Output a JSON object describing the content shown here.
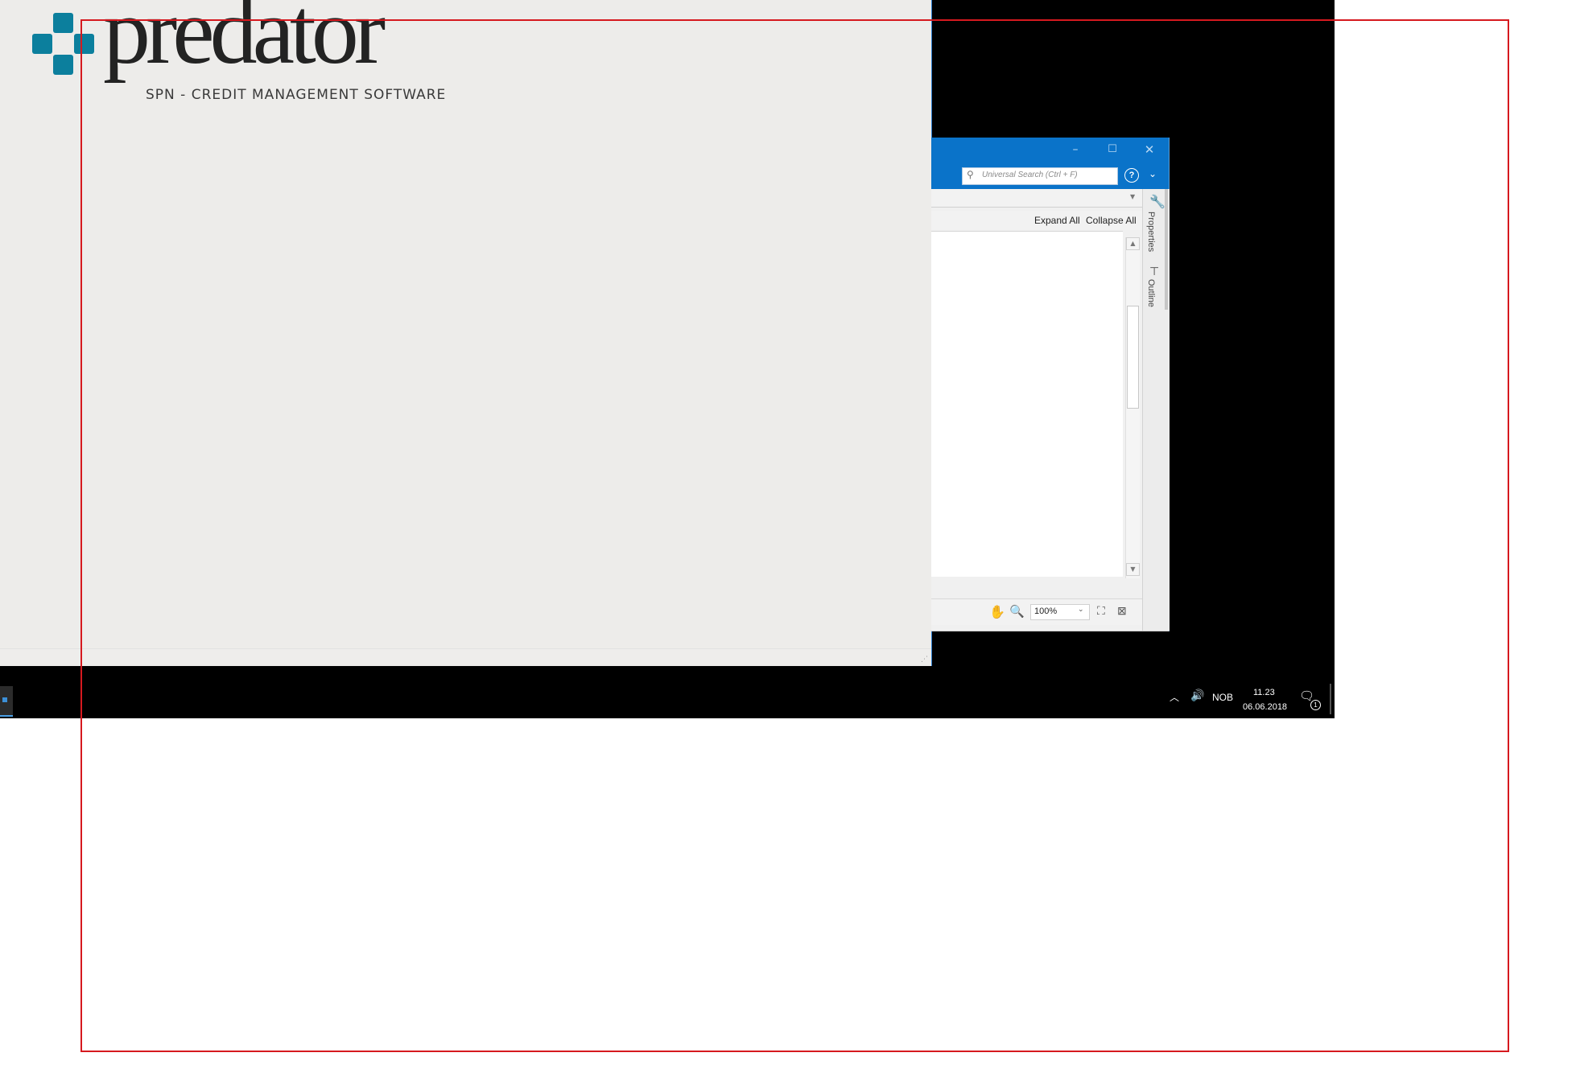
{
  "splash": {
    "logo_word": "predator",
    "tagline": "SPN - CREDIT MANAGEMENT SOFTWARE",
    "brand_color": "#0c7f9d"
  },
  "report_window": {
    "title_bar_color": "#0a73c9",
    "search_placeholder": "Universal Search (Ctrl + F)",
    "help_label": "?",
    "expand_all": "Expand All",
    "collapse_all": "Collapse All",
    "side_tabs": [
      "Properties",
      "Outline"
    ],
    "zoom": "100%"
  },
  "taskbar": {
    "language": "NOB",
    "time": "11.23",
    "date": "06.06.2018",
    "notification_count": "1"
  },
  "annotation": {
    "color": "#d6191f"
  }
}
